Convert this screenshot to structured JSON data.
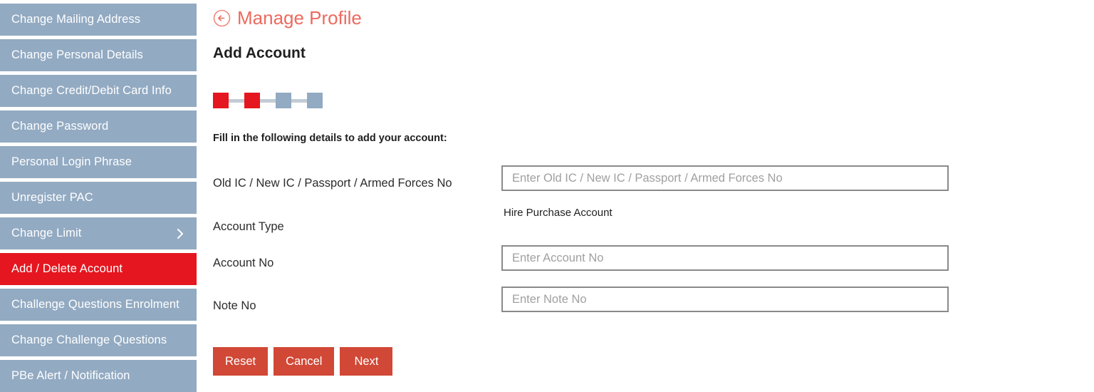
{
  "sidebar": {
    "items": [
      {
        "label": "Change Mailing Address",
        "active": false,
        "has_chevron": false
      },
      {
        "label": "Change Personal Details",
        "active": false,
        "has_chevron": false
      },
      {
        "label": "Change Credit/Debit Card Info",
        "active": false,
        "has_chevron": false
      },
      {
        "label": "Change Password",
        "active": false,
        "has_chevron": false
      },
      {
        "label": "Personal Login Phrase",
        "active": false,
        "has_chevron": false
      },
      {
        "label": "Unregister PAC",
        "active": false,
        "has_chevron": false
      },
      {
        "label": "Change Limit",
        "active": false,
        "has_chevron": true
      },
      {
        "label": "Add / Delete Account",
        "active": true,
        "has_chevron": false
      },
      {
        "label": "Challenge Questions Enrolment",
        "active": false,
        "has_chevron": false
      },
      {
        "label": "Change Challenge Questions",
        "active": false,
        "has_chevron": false
      },
      {
        "label": "PBe Alert / Notification",
        "active": false,
        "has_chevron": false
      }
    ]
  },
  "header": {
    "back_icon": "circle-arrow-left-icon",
    "title": "Manage Profile"
  },
  "main": {
    "section_title": "Add Account",
    "intro_text": "Fill in the following details to add your account:"
  },
  "stepper": {
    "total_steps": 4,
    "completed_steps": 2,
    "steps": [
      {
        "state": "done"
      },
      {
        "state": "done"
      },
      {
        "state": "pending"
      },
      {
        "state": "pending"
      }
    ]
  },
  "form": {
    "fields": [
      {
        "label": "Old IC / New IC / Passport / Armed Forces No",
        "placeholder": "Enter Old IC / New IC / Passport / Armed Forces No",
        "value": ""
      },
      {
        "label": "Account Type",
        "value": "Hire Purchase Account"
      },
      {
        "label": "Account No",
        "placeholder": "Enter Account No",
        "value": ""
      },
      {
        "label": "Note No",
        "placeholder": "Enter Note No",
        "value": ""
      }
    ]
  },
  "actions": {
    "reset_label": "Reset",
    "cancel_label": "Cancel",
    "next_label": "Next"
  },
  "colors": {
    "accent_red": "#e5161f",
    "button_red": "#d14836",
    "title_red": "#ed6a5e",
    "nav_blue_gray": "#92aac2",
    "step_line": "#c3ccd4",
    "field_border": "#8a8a8a",
    "placeholder": "#a0a0a0"
  }
}
